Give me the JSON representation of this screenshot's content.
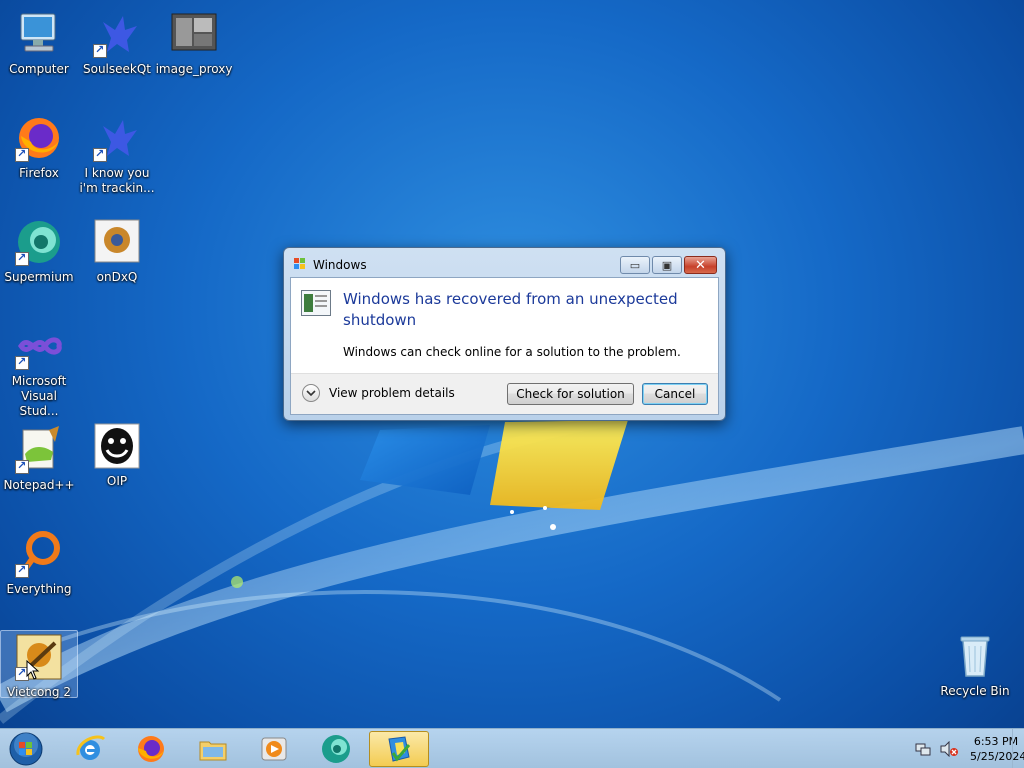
{
  "desktop": {
    "icons": [
      {
        "label": "Computer"
      },
      {
        "label": "SoulseekQt"
      },
      {
        "label": "image_proxy"
      },
      {
        "label": "Firefox"
      },
      {
        "label": "I know you i'm trackin..."
      },
      {
        "label": "Supermium"
      },
      {
        "label": "onDxQ"
      },
      {
        "label": "Microsoft Visual Stud..."
      },
      {
        "label": "Notepad++"
      },
      {
        "label": "OIP"
      },
      {
        "label": "Everything"
      },
      {
        "label": "Vietcong 2"
      },
      {
        "label": "Recycle Bin"
      }
    ]
  },
  "dialog": {
    "title": "Windows",
    "heading": "Windows has recovered from an unexpected shutdown",
    "subtext": "Windows can check online for a solution to the problem.",
    "details_label": "View problem details",
    "check_label": "Check for solution",
    "cancel_label": "Cancel",
    "minimize_glyph": "▭",
    "maximize_glyph": "▣",
    "close_glyph": "✕"
  },
  "taskbar": {
    "items": [
      {
        "name": "Internet Explorer"
      },
      {
        "name": "Firefox"
      },
      {
        "name": "Windows Explorer"
      },
      {
        "name": "Windows Media Player"
      },
      {
        "name": "Supermium"
      },
      {
        "name": "Windows Problem Reporting",
        "active": true
      }
    ],
    "clock": {
      "time": "6:53 PM",
      "date": "5/25/2024"
    }
  },
  "colors": {
    "heading": "#1c3a9a",
    "taskbar_active": "#f3cc52"
  }
}
